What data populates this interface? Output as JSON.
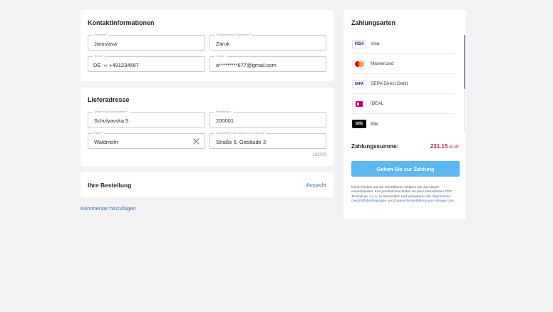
{
  "contact": {
    "title": "Kontaktinformationen",
    "first_name": {
      "label": "Vorname *",
      "value": "Jaroslava"
    },
    "last_name": {
      "label": "Familienname, Nachname *",
      "value": "Zaruk"
    },
    "phone": {
      "label": "Telefon",
      "country": "DE",
      "value": "+491234567"
    },
    "email": {
      "label": "E-Mail *",
      "value": "a*********677@gmail.com"
    }
  },
  "address": {
    "title": "Lieferadresse",
    "street": {
      "label": "Straße und Hausnummer *",
      "value": "Schulyavska 5"
    },
    "postal": {
      "label": "Postleitzahl *",
      "value": "200001"
    },
    "city": {
      "label": "Stadt *",
      "value": "Waldmohr"
    },
    "extra": {
      "label": "Zusätzliche Informationen zur Adresse",
      "value": "Straße 5, Gebäude 3"
    },
    "counter": "19/200"
  },
  "order": {
    "title": "Ihre Bestellung",
    "view_link": "Aussicht"
  },
  "comment_link": "Kommentar hinzufügen",
  "payment": {
    "title": "Zahlungsarten",
    "methods": [
      {
        "name": "Visa",
        "logo": "visa-logo",
        "logo_text": "VISA"
      },
      {
        "name": "Mastercard",
        "logo": "mastercard-logo"
      },
      {
        "name": "SEPA Direct Debit",
        "logo": "sepa-logo",
        "logo_text": "S€PA"
      },
      {
        "name": "iDEAL",
        "logo": "ideal-logo"
      },
      {
        "name": "Blik",
        "logo": "blik-logo",
        "logo_text": "blik"
      }
    ],
    "total_label": "Zahlungssumme:",
    "total_amount": "231.15",
    "total_currency": "EUR",
    "button_label": "Gehen Sie zur Zahlung",
    "legal_1": "Durch Klicken auf die Schaltfläche erklären Sie sich damit einverstanden, Ihre persönlichen Daten an das Unternehmen TOP Technik sp. z o.o. zu übermitteln und akzeptieren die ",
    "legal_link_1": "Allgemeinen Geschäftsbedingungen",
    "legal_2": " und ",
    "legal_link_2": "Datenschutzerklärung",
    "legal_3": " von ",
    "legal_link_3": "Vitrager.com"
  },
  "colors": {
    "accent_button": "#5cb8f0",
    "total_red": "#c2243a",
    "link_blue": "#3a6fc4"
  }
}
